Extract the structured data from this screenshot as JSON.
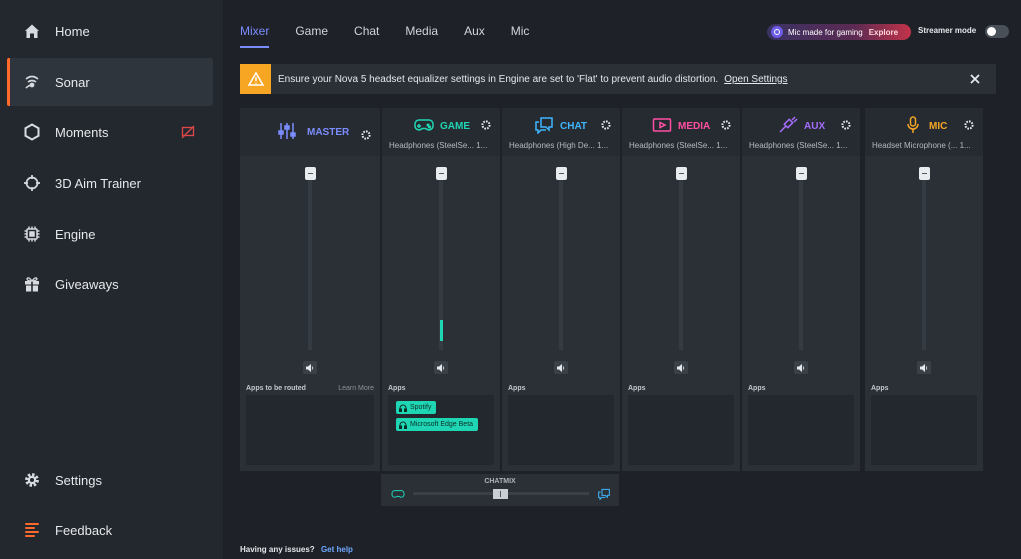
{
  "sidebar": {
    "items": [
      {
        "label": "Home",
        "icon": "home-icon"
      },
      {
        "label": "Sonar",
        "icon": "sonar-icon",
        "active": true
      },
      {
        "label": "Moments",
        "icon": "hexagon-icon"
      },
      {
        "label": "3D Aim Trainer",
        "icon": "aim-icon"
      },
      {
        "label": "Engine",
        "icon": "chip-icon"
      },
      {
        "label": "Giveaways",
        "icon": "gift-icon"
      },
      {
        "label": "Settings",
        "icon": "gear-icon"
      },
      {
        "label": "Feedback",
        "icon": "feedback-icon"
      }
    ]
  },
  "tabs": [
    {
      "label": "Mixer",
      "active": true
    },
    {
      "label": "Game"
    },
    {
      "label": "Chat"
    },
    {
      "label": "Media"
    },
    {
      "label": "Aux"
    },
    {
      "label": "Mic"
    }
  ],
  "promo": {
    "text": "Mic made for gaming",
    "action": "Explore"
  },
  "streamer_mode": {
    "label": "Streamer mode",
    "on": false
  },
  "banner": {
    "message": "Ensure your Nova 5 headset equalizer settings in Engine are set to 'Flat' to prevent audio distortion.",
    "link": "Open Settings"
  },
  "colors": {
    "accent": "#7b8cff",
    "master": "#7b8cff",
    "game": "#1fd6b4",
    "chat": "#3fb6ff",
    "media": "#ff4fa3",
    "aux": "#a56cff",
    "mic": "#f6a623",
    "warning": "#f6a623",
    "active_bar": "#ff6a2c"
  },
  "channels": {
    "master": {
      "name": "MASTER",
      "apps_label": "Apps to be routed",
      "learn_more": "Learn More"
    },
    "game": {
      "name": "GAME",
      "device": "Headphones (SteelSe... 1...",
      "apps_label": "Apps",
      "level": 0.12,
      "apps": [
        "Spotify",
        "Microsoft Edge Beta"
      ]
    },
    "chat": {
      "name": "CHAT",
      "device": "Headphones (High De... 1...",
      "apps_label": "Apps"
    },
    "media": {
      "name": "MEDIA",
      "device": "Headphones (SteelSe... 1...",
      "apps_label": "Apps"
    },
    "aux": {
      "name": "AUX",
      "device": "Headphones (SteelSe... 1...",
      "apps_label": "Apps"
    },
    "mic": {
      "name": "MIC",
      "device": "Headset Microphone (... 1...",
      "apps_label": "Apps"
    }
  },
  "chatmix": {
    "label": "CHATMIX",
    "value": 0.5
  },
  "footer": {
    "text": "Having any issues?",
    "link": "Get help"
  }
}
